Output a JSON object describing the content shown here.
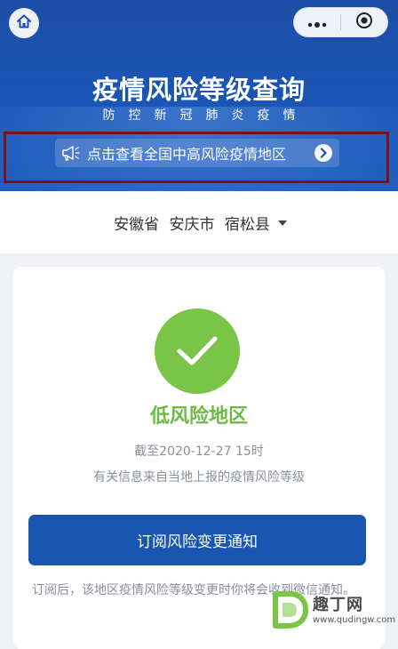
{
  "header": {
    "home_icon": "home-icon",
    "more_icon": "more-dots-icon",
    "close_icon": "target-close-icon",
    "title": "疫情风险等级查询",
    "subtitle": "防控新冠肺炎疫情",
    "notice": {
      "icon": "megaphone-icon",
      "text": "点击查看全国中高风险疫情地区",
      "arrow_icon": "chevron-right-icon"
    },
    "colors": {
      "banner": "#1a56b6",
      "highlight_border": "#7a1118"
    }
  },
  "location": {
    "province": "安徽省",
    "city": "安庆市",
    "county": "宿松县",
    "dropdown_icon": "caret-down-icon"
  },
  "result": {
    "status_icon": "check-circle-icon",
    "risk_level": "低风险地区",
    "as_of": "截至2020-12-27 15时",
    "source": "有关信息来自当地上报的疫情风险等级",
    "colors": {
      "low_risk": "#6fb944"
    }
  },
  "subscribe": {
    "label": "订阅风险变更通知",
    "note": "订阅后，该地区疫情风险等级变更时你将会收到微信通知。",
    "color": "#1b55b2"
  },
  "watermark": {
    "name": "趣丁网",
    "url": "www.qudingw.com"
  }
}
